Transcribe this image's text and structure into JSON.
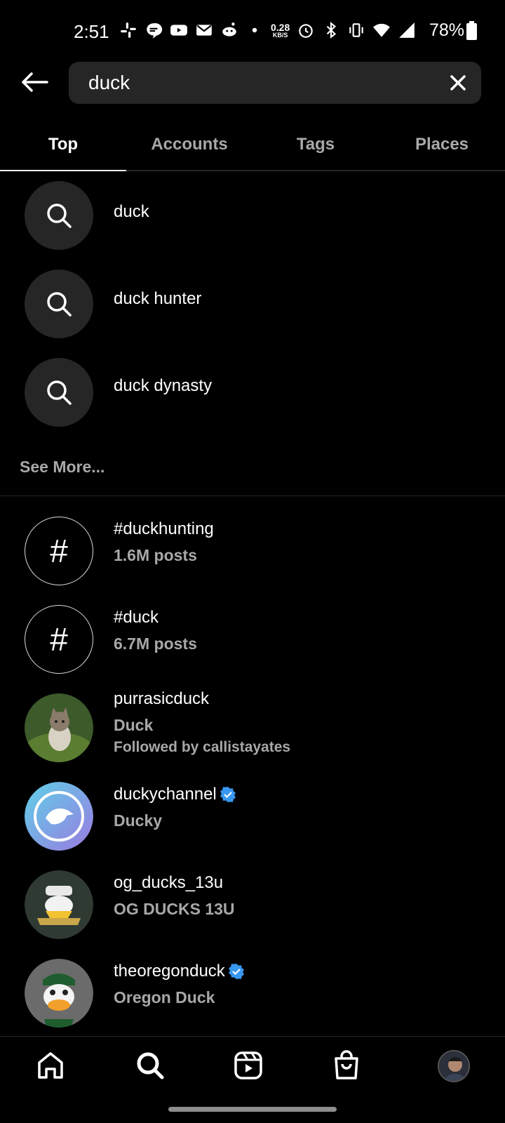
{
  "status_bar": {
    "time": "2:51",
    "speed_value": "0.28",
    "speed_unit": "KB/S",
    "battery": "78%"
  },
  "search": {
    "query": "duck",
    "back_icon": "arrow-left-icon",
    "clear_icon": "close-icon"
  },
  "tabs": [
    {
      "label": "Top",
      "active": true
    },
    {
      "label": "Accounts",
      "active": false
    },
    {
      "label": "Tags",
      "active": false
    },
    {
      "label": "Places",
      "active": false
    }
  ],
  "suggestions": [
    {
      "text": "duck"
    },
    {
      "text": "duck hunter"
    },
    {
      "text": "duck dynasty"
    }
  ],
  "see_more": "See More...",
  "hashtags": [
    {
      "tag": "#duckhunting",
      "count": "1.6M posts"
    },
    {
      "tag": "#duck",
      "count": "6.7M posts"
    }
  ],
  "accounts": [
    {
      "username": "purrasicduck",
      "name": "Duck",
      "followed_by": "Followed by callistayates",
      "verified": false
    },
    {
      "username": "duckychannel",
      "name": "Ducky",
      "verified": true
    },
    {
      "username": "og_ducks_13u",
      "name": "OG DUCKS 13U",
      "verified": false
    },
    {
      "username": "theoregonduck",
      "name": "Oregon Duck",
      "verified": true
    }
  ],
  "bottom_nav": [
    "home-icon",
    "search-icon",
    "reels-icon",
    "shop-icon",
    "profile-avatar"
  ],
  "colors": {
    "background": "#000000",
    "secondary_text": "#a8a8a8",
    "field": "#262626",
    "verified": "#3897f0"
  }
}
